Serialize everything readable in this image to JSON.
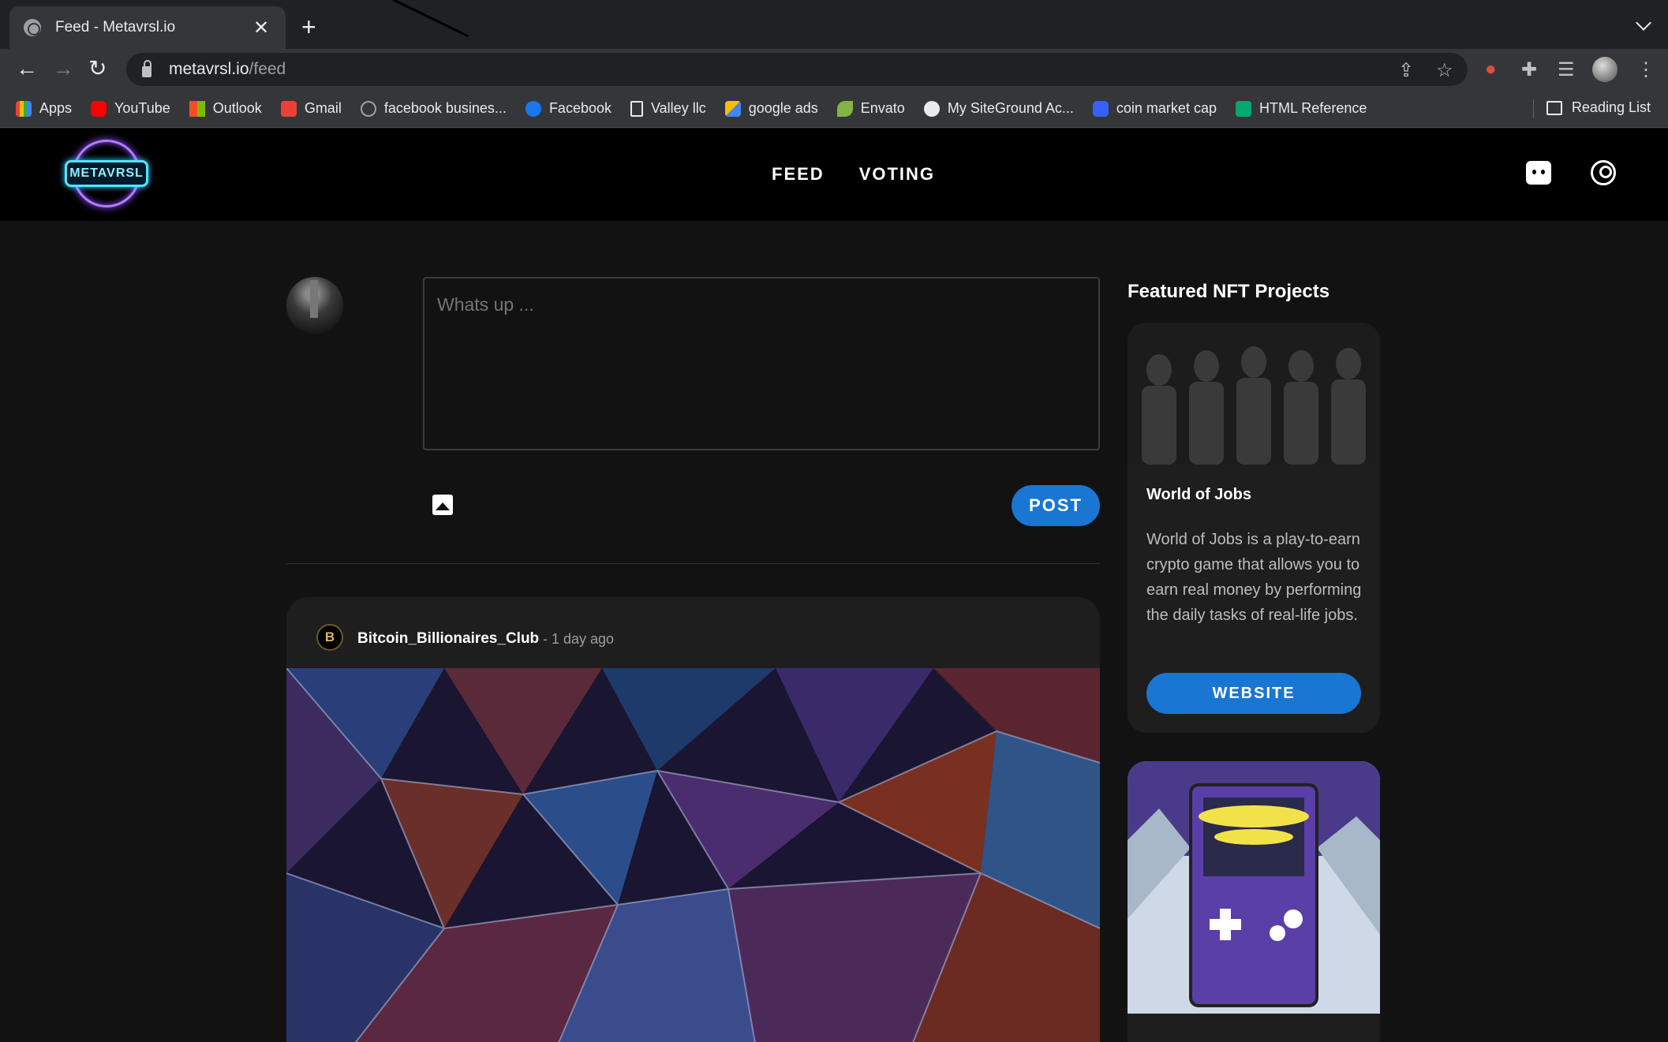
{
  "browser": {
    "tab_title": "Feed - Metavrsl.io",
    "tab_close": "✕",
    "new_tab": "+",
    "url_host": "metavrsl.io",
    "url_path": "/feed",
    "back": "←",
    "forward": "→",
    "reload": "↻",
    "bookmarks": [
      {
        "label": "Apps",
        "color": "#4285f4"
      },
      {
        "label": "YouTube",
        "color": "#ff0000"
      },
      {
        "label": "Outlook",
        "color": "#f25022"
      },
      {
        "label": "Gmail",
        "color": "#ea4335"
      },
      {
        "label": "facebook busines...",
        "color": "#5f6368"
      },
      {
        "label": "Facebook",
        "color": "#1877f2"
      },
      {
        "label": "Valley llc",
        "color": "#9aa0a6"
      },
      {
        "label": "google ads",
        "color": "#fbbc04"
      },
      {
        "label": "Envato",
        "color": "#82b541"
      },
      {
        "label": "My SiteGround Ac...",
        "color": "#e8eaed"
      },
      {
        "label": "coin market cap",
        "color": "#3861fb"
      },
      {
        "label": "HTML Reference",
        "color": "#04aa6d"
      }
    ],
    "reading_list": "Reading List"
  },
  "site": {
    "logo_text": "METAVRSL",
    "nav": {
      "feed": "FEED",
      "voting": "VOTING"
    },
    "accent": "#1976d2"
  },
  "composer": {
    "placeholder": "Whats up ...",
    "post_label": "POST"
  },
  "post": {
    "author": "Bitcoin_Billionaires_Club",
    "time": "- 1 day ago",
    "avatar_letter": "B"
  },
  "featured": {
    "title": "Featured NFT Projects",
    "projects": [
      {
        "name": "World of Jobs",
        "description": "World of Jobs is a play-to-earn crypto game that allows you to earn real money by performing the daily tasks of real-life jobs.",
        "button": "WEBSITE"
      }
    ]
  }
}
